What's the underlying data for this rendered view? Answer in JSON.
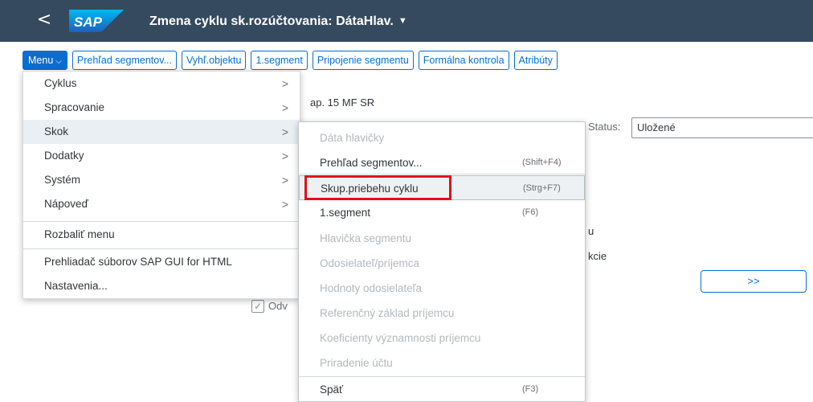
{
  "shell": {
    "back_glyph": "<",
    "logo_text": "SAP",
    "title": "Zmena cyklu sk.rozúčtovania: DátaHlav.",
    "title_caret": "▼"
  },
  "toolbar": {
    "menu_label": "Menu",
    "menu_chevron": "⌵",
    "buttons": [
      "Prehľad segmentov...",
      "Vyhľ.objektu",
      "1.segment",
      "Pripojenie segmentu",
      "Formálna kontrola",
      "Atribúty"
    ]
  },
  "background": {
    "partial_text_1": "ap. 15 MF SR",
    "status_label": "Status:",
    "status_value": "Uložené",
    "partial_text_2": "u",
    "partial_text_3": "kcie",
    "next_button": ">>",
    "checkbox_mark": "✓",
    "checkbox_label_partial": "Odv"
  },
  "menu": {
    "items": [
      {
        "label": "Cyklus",
        "arrow": ">"
      },
      {
        "label": "Spracovanie",
        "arrow": ">"
      },
      {
        "label": "Skok",
        "arrow": ">"
      },
      {
        "label": "Dodatky",
        "arrow": ">"
      },
      {
        "label": "Systém",
        "arrow": ">"
      },
      {
        "label": "Nápoveď",
        "arrow": ">"
      },
      {
        "label": "Rozbaliť menu",
        "arrow": ""
      },
      {
        "label": "Prehliadač súborov SAP GUI for HTML",
        "arrow": ""
      },
      {
        "label": "Nastavenia...",
        "arrow": ""
      }
    ],
    "active_item": "Skok"
  },
  "submenu": {
    "items": [
      {
        "label": "Dáta hlavičky",
        "shortcut": "",
        "enabled": false
      },
      {
        "label": "Prehľad segmentov...",
        "shortcut": "(Shift+F4)",
        "enabled": true
      },
      {
        "label": "Skup.priebehu cyklu",
        "shortcut": "(Strg+F7)",
        "enabled": true,
        "highlighted": true
      },
      {
        "label": "1.segment",
        "shortcut": "(F6)",
        "enabled": true
      },
      {
        "label": "Hlavička segmentu",
        "shortcut": "",
        "enabled": false
      },
      {
        "label": "Odosielateľ/príjemca",
        "shortcut": "",
        "enabled": false
      },
      {
        "label": "Hodnoty odosielateľa",
        "shortcut": "",
        "enabled": false
      },
      {
        "label": "Referenčný základ príjemcu",
        "shortcut": "",
        "enabled": false
      },
      {
        "label": "Koeficienty významnosti príjemcu",
        "shortcut": "",
        "enabled": false
      },
      {
        "label": "Priradenie účtu",
        "shortcut": "",
        "enabled": false
      },
      {
        "label": "Späť",
        "shortcut": "(F3)",
        "enabled": true
      }
    ]
  },
  "colors": {
    "shell_bg": "#354a5f",
    "accent": "#0a6ed1",
    "highlight_box": "#e0101a",
    "disabled_text": "#b4b8bc"
  }
}
